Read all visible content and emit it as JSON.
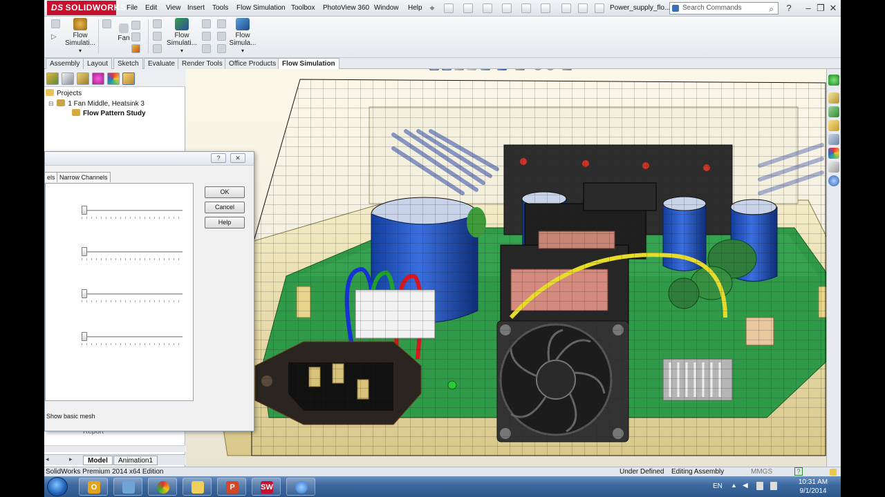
{
  "app": {
    "brand": "SOLIDWORKS",
    "document_title": "Power_supply_flo...",
    "search_placeholder": "Search Commands"
  },
  "menu": [
    "File",
    "Edit",
    "View",
    "Insert",
    "Tools",
    "Flow Simulation",
    "Toolbox",
    "PhotoView 360",
    "Window",
    "Help"
  ],
  "command_manager": {
    "items": [
      {
        "label": "Flow Simulati..."
      },
      {
        "label": "Fan"
      },
      {
        "label": "Flow Simulati..."
      },
      {
        "label": "Flow Simula..."
      }
    ]
  },
  "tabs": [
    {
      "label": "Assembly"
    },
    {
      "label": "Layout"
    },
    {
      "label": "Sketch"
    },
    {
      "label": "Evaluate"
    },
    {
      "label": "Render Tools"
    },
    {
      "label": "Office Products"
    },
    {
      "label": "Flow Simulation"
    }
  ],
  "tree": {
    "root": "Projects",
    "project": "1 Fan Middle, Heatsink 3",
    "study": "Flow Pattern Study",
    "hidden_item": "Report"
  },
  "dialog": {
    "help_glyph": "?",
    "close_glyph": "✕",
    "tab_partial": "els",
    "tab_narrow": "Narrow Channels",
    "ok": "OK",
    "cancel": "Cancel",
    "help": "Help",
    "show_basic_mesh": "Show basic mesh",
    "slider_values": [
      0,
      0,
      0,
      0
    ]
  },
  "bottom_tabs": [
    {
      "label": "Model"
    },
    {
      "label": "Animation1"
    }
  ],
  "status": {
    "edition": "SolidWorks Premium 2014 x64 Edition",
    "defined": "Under Defined",
    "mode": "Editing Assembly",
    "units": "MMGS",
    "help_glyph": "?"
  },
  "taskbar": {
    "language": "EN",
    "time": "10:31 AM",
    "date": "9/1/2014",
    "apps": [
      "outlook",
      "explorer",
      "chrome",
      "folder",
      "powerpoint",
      "solidworks",
      "flow-app"
    ]
  },
  "colors": {
    "brand_red": "#c8102e",
    "pcb_green": "#2f9a47",
    "capacitor_blue": "#1f55c8",
    "enclosure_tan": "#efe3b2"
  }
}
